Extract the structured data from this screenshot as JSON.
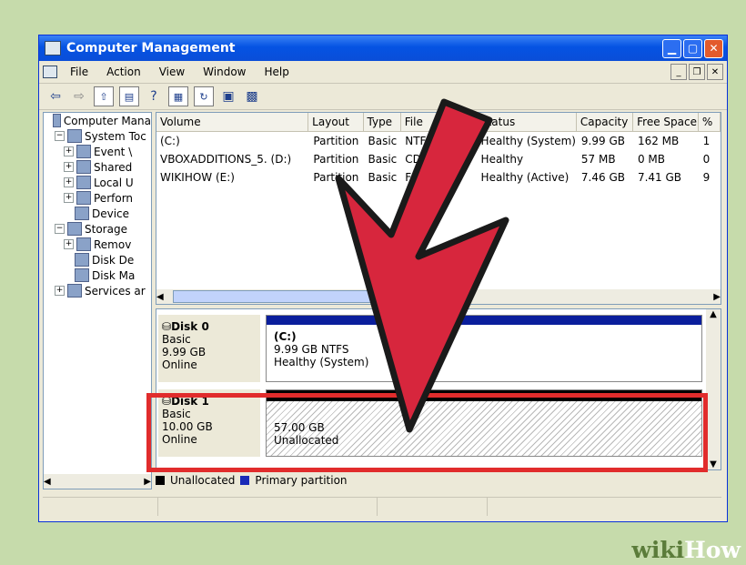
{
  "window": {
    "title": "Computer Management"
  },
  "menu": [
    "File",
    "Action",
    "View",
    "Window",
    "Help"
  ],
  "tree": [
    {
      "label": "Computer Mana",
      "level": 0,
      "pm": ""
    },
    {
      "label": "System Toc",
      "level": 1,
      "pm": "−"
    },
    {
      "label": "Event \\",
      "level": 2,
      "pm": "+"
    },
    {
      "label": "Shared",
      "level": 2,
      "pm": "+"
    },
    {
      "label": "Local U",
      "level": 2,
      "pm": "+"
    },
    {
      "label": "Perforn",
      "level": 2,
      "pm": "+"
    },
    {
      "label": "Device",
      "level": 2,
      "pm": ""
    },
    {
      "label": "Storage",
      "level": 1,
      "pm": "−"
    },
    {
      "label": "Remov",
      "level": 2,
      "pm": "+"
    },
    {
      "label": "Disk De",
      "level": 2,
      "pm": ""
    },
    {
      "label": "Disk Ma",
      "level": 2,
      "pm": ""
    },
    {
      "label": "Services ar",
      "level": 1,
      "pm": "+"
    }
  ],
  "volumes": {
    "headers": [
      "Volume",
      "Layout",
      "Type",
      "File",
      "Status",
      "Capacity",
      "Free Space",
      "%"
    ],
    "rows": [
      [
        "(C:)",
        "Partition",
        "Basic",
        "NTF",
        "Healthy (System)",
        "9.99 GB",
        "162 MB",
        "1"
      ],
      [
        "VBOXADDITIONS_5. (D:)",
        "Partition",
        "Basic",
        "CD",
        "Healthy",
        "57 MB",
        "0 MB",
        "0"
      ],
      [
        "WIKIHOW (E:)",
        "Partition",
        "Basic",
        "FA",
        "Healthy (Active)",
        "7.46 GB",
        "7.41 GB",
        "9"
      ]
    ]
  },
  "disks": [
    {
      "name": "Disk 0",
      "type": "Basic",
      "size": "9.99 GB",
      "state": "Online",
      "part_title": "(C:)",
      "part_size": "9.99 GB NTFS",
      "part_status": "Healthy (System)"
    },
    {
      "name": "Disk 1",
      "type": "Basic",
      "size": "10.00 GB",
      "state": "Online",
      "part_title": "",
      "part_size": "57.00 GB",
      "part_status": "Unallocated"
    }
  ],
  "legend": [
    {
      "label": "Unallocated",
      "color": "#000000"
    },
    {
      "label": "Primary partition",
      "color": "#1a2ab8"
    }
  ],
  "watermark": {
    "wiki": "wiki",
    "how": "How"
  },
  "colors": {
    "titlebar": "#0553e3",
    "highlight": "#e12c2c",
    "arrow": "#d7263d",
    "primary_bar": "#0a1e9c"
  }
}
